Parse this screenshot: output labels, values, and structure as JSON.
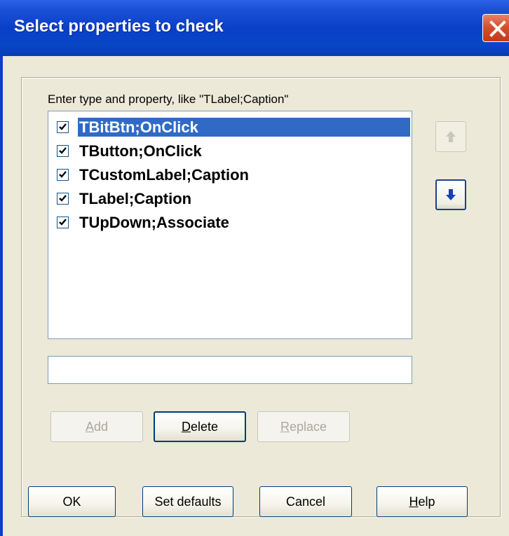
{
  "window": {
    "title": "Select properties to check"
  },
  "hint": "Enter type and property, like \"TLabel;Caption\"",
  "list": {
    "items": [
      {
        "label": "TBitBtn;OnClick",
        "checked": true,
        "selected": true
      },
      {
        "label": "TButton;OnClick",
        "checked": true,
        "selected": false
      },
      {
        "label": "TCustomLabel;Caption",
        "checked": true,
        "selected": false
      },
      {
        "label": "TLabel;Caption",
        "checked": true,
        "selected": false
      },
      {
        "label": "TUpDown;Associate",
        "checked": true,
        "selected": false
      }
    ]
  },
  "edit": {
    "value": ""
  },
  "buttons": {
    "add": {
      "mnemonic": "A",
      "rest": "dd",
      "enabled": false
    },
    "delete": {
      "mnemonic": "D",
      "rest": "elete",
      "enabled": true
    },
    "replace": {
      "mnemonic": "R",
      "rest": "eplace",
      "enabled": false
    },
    "ok": "OK",
    "set_defaults": "Set defaults",
    "cancel": "Cancel",
    "help": {
      "mnemonic": "H",
      "rest": "elp"
    }
  },
  "icons": {
    "close": "close-icon",
    "move_up": "arrow-up-icon",
    "move_down": "arrow-down-icon",
    "checkbox": "checkmark-icon"
  },
  "colors": {
    "titlebar": "#0a3fc8",
    "selection": "#316ac5",
    "face": "#ece9d8"
  }
}
